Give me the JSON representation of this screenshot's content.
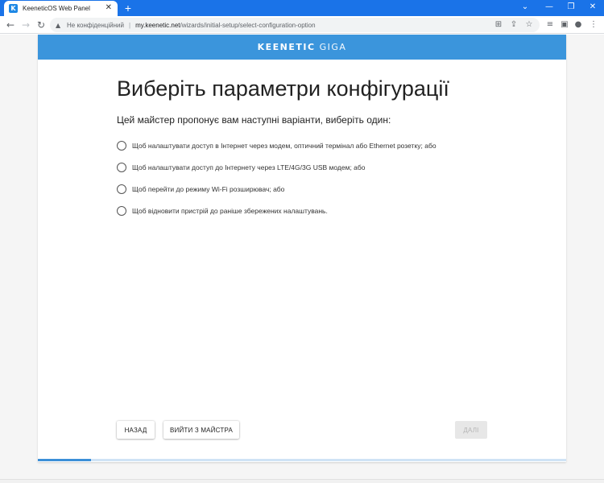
{
  "browser": {
    "tab_title": "KeeneticOS Web Panel",
    "tab_favicon_letter": "K",
    "tab_close_glyph": "✕",
    "new_tab_glyph": "+",
    "window_controls": [
      "⌄",
      "—",
      "❐",
      "✕"
    ],
    "nav": {
      "back": "←",
      "forward": "→",
      "reload": "↻"
    },
    "address": {
      "security_label": "Не конфіденційний",
      "separator": "|",
      "host": "my.keenetic.net",
      "path": "/wizards/initial-setup/select-configuration-option"
    },
    "toolbar_icons": [
      "translate-icon",
      "share-icon",
      "bookmark-star-icon",
      "reading-list-icon",
      "side-panel-icon",
      "profile-icon",
      "menu-icon"
    ],
    "accent_color": "#1a73e8"
  },
  "header": {
    "logo_brand": "KEENETIC",
    "logo_model": "GIGA",
    "color": "#3b95dc"
  },
  "main": {
    "title": "Виберіть параметри конфігурації",
    "subtitle": "Цей майстер пропонує вам наступні варіанти, виберіть один:",
    "options": [
      {
        "label": "Щоб налаштувати доступ в Інтернет через модем, оптичний термінал або Ethernet розетку; або",
        "selected": false
      },
      {
        "label": "Щоб налаштувати доступ до Інтернету через LTE/4G/3G USB модем; або",
        "selected": false
      },
      {
        "label": "Щоб перейти до режиму Wi-Fi розширювач; або",
        "selected": false
      },
      {
        "label": "Щоб відновити пристрій до раніше збережених налаштувань.",
        "selected": false
      }
    ]
  },
  "footer": {
    "back_label": "НАЗАД",
    "exit_label": "ВИЙТИ З МАЙСТРА",
    "next_label": "ДАЛІ",
    "next_enabled": false,
    "progress": 0.1
  }
}
